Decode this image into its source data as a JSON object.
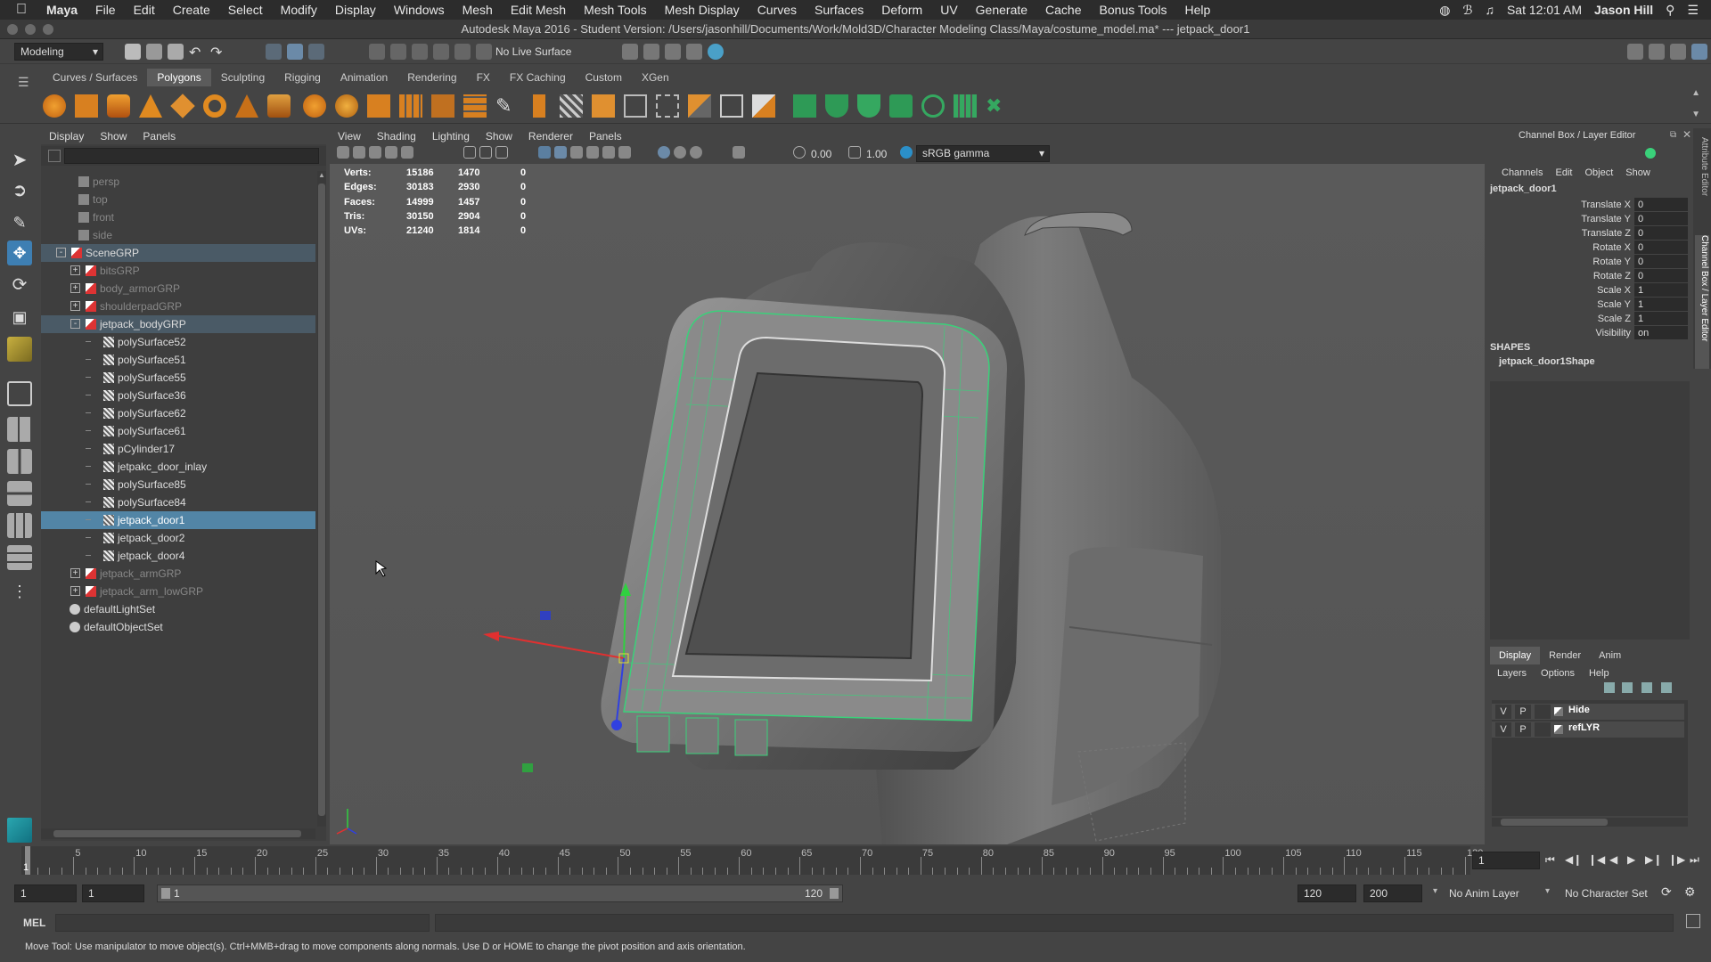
{
  "menubar": {
    "app": "Maya",
    "items": [
      "File",
      "Edit",
      "Create",
      "Select",
      "Modify",
      "Display",
      "Windows",
      "Mesh",
      "Edit Mesh",
      "Mesh Tools",
      "Mesh Display",
      "Curves",
      "Surfaces",
      "Deform",
      "UV",
      "Generate",
      "Cache",
      "Bonus Tools",
      "Help"
    ],
    "clock": "Sat 12:01 AM",
    "user": "Jason Hill"
  },
  "window_title": "Autodesk Maya 2016 - Student Version: /Users/jasonhill/Documents/Work/Mold3D/Character Modeling Class/Maya/costume_model.ma*  ---  jetpack_door1",
  "statusline": {
    "menuset": "Modeling",
    "live_surface": "No Live Surface"
  },
  "shelf": {
    "tabs": [
      "Curves / Surfaces",
      "Polygons",
      "Sculpting",
      "Rigging",
      "Animation",
      "Rendering",
      "FX",
      "FX Caching",
      "Custom",
      "XGen"
    ],
    "active": "Polygons"
  },
  "outliner": {
    "menu": [
      "Display",
      "Show",
      "Panels"
    ],
    "rows": [
      {
        "label": "persp",
        "depth": 2,
        "style": "grey",
        "kind": "camera"
      },
      {
        "label": "top",
        "depth": 2,
        "style": "grey",
        "kind": "camera"
      },
      {
        "label": "front",
        "depth": 2,
        "style": "grey",
        "kind": "camera"
      },
      {
        "label": "side",
        "depth": 2,
        "style": "grey",
        "kind": "camera"
      },
      {
        "label": "SceneGRP",
        "depth": 1,
        "style": "hl",
        "kind": "group",
        "exp": "-"
      },
      {
        "label": "bitsGRP",
        "depth": 2,
        "style": "grey",
        "kind": "group",
        "exp": "+"
      },
      {
        "label": "body_armorGRP",
        "depth": 2,
        "style": "grey",
        "kind": "group",
        "exp": "+"
      },
      {
        "label": "shoulderpadGRP",
        "depth": 2,
        "style": "grey",
        "kind": "group",
        "exp": "+"
      },
      {
        "label": "jetpack_bodyGRP",
        "depth": 2,
        "style": "hl",
        "kind": "group",
        "exp": "-"
      },
      {
        "label": "polySurface52",
        "depth": 3,
        "style": "",
        "kind": "mesh"
      },
      {
        "label": "polySurface51",
        "depth": 3,
        "style": "",
        "kind": "mesh"
      },
      {
        "label": "polySurface55",
        "depth": 3,
        "style": "",
        "kind": "mesh"
      },
      {
        "label": "polySurface36",
        "depth": 3,
        "style": "",
        "kind": "mesh"
      },
      {
        "label": "polySurface62",
        "depth": 3,
        "style": "",
        "kind": "mesh"
      },
      {
        "label": "polySurface61",
        "depth": 3,
        "style": "",
        "kind": "mesh"
      },
      {
        "label": "pCylinder17",
        "depth": 3,
        "style": "",
        "kind": "mesh"
      },
      {
        "label": "jetpakc_door_inlay",
        "depth": 3,
        "style": "",
        "kind": "mesh"
      },
      {
        "label": "polySurface85",
        "depth": 3,
        "style": "",
        "kind": "mesh"
      },
      {
        "label": "polySurface84",
        "depth": 3,
        "style": "",
        "kind": "mesh"
      },
      {
        "label": "jetpack_door1",
        "depth": 3,
        "style": "sel",
        "kind": "mesh"
      },
      {
        "label": "jetpack_door2",
        "depth": 3,
        "style": "",
        "kind": "mesh"
      },
      {
        "label": "jetpack_door4",
        "depth": 3,
        "style": "",
        "kind": "mesh"
      },
      {
        "label": "jetpack_armGRP",
        "depth": 2,
        "style": "grey",
        "kind": "group",
        "exp": "+"
      },
      {
        "label": "jetpack_arm_lowGRP",
        "depth": 2,
        "style": "grey",
        "kind": "group",
        "exp": "+"
      },
      {
        "label": "defaultLightSet",
        "depth": 1,
        "style": "",
        "kind": "set"
      },
      {
        "label": "defaultObjectSet",
        "depth": 1,
        "style": "",
        "kind": "set"
      }
    ]
  },
  "viewport": {
    "menu": [
      "View",
      "Shading",
      "Lighting",
      "Show",
      "Renderer",
      "Panels"
    ],
    "exposure": "0.00",
    "gamma": "1.00",
    "colorspace": "sRGB gamma",
    "hud": [
      {
        "label": "Verts:",
        "a": "15186",
        "b": "1470",
        "c": "0"
      },
      {
        "label": "Edges:",
        "a": "30183",
        "b": "2930",
        "c": "0"
      },
      {
        "label": "Faces:",
        "a": "14999",
        "b": "1457",
        "c": "0"
      },
      {
        "label": "Tris:",
        "a": "30150",
        "b": "2904",
        "c": "0"
      },
      {
        "label": "UVs:",
        "a": "21240",
        "b": "1814",
        "c": "0"
      }
    ]
  },
  "channelbox": {
    "title": "Channel Box / Layer Editor",
    "menu": [
      "Channels",
      "Edit",
      "Object",
      "Show"
    ],
    "object": "jetpack_door1",
    "attrs": [
      {
        "name": "Translate X",
        "value": "0"
      },
      {
        "name": "Translate Y",
        "value": "0"
      },
      {
        "name": "Translate Z",
        "value": "0"
      },
      {
        "name": "Rotate X",
        "value": "0"
      },
      {
        "name": "Rotate Y",
        "value": "0"
      },
      {
        "name": "Rotate Z",
        "value": "0"
      },
      {
        "name": "Scale X",
        "value": "1"
      },
      {
        "name": "Scale Y",
        "value": "1"
      },
      {
        "name": "Scale Z",
        "value": "1"
      },
      {
        "name": "Visibility",
        "value": "on"
      }
    ],
    "shapes_label": "SHAPES",
    "shape": "jetpack_door1Shape",
    "side_tabs": [
      "Attribute Editor",
      "Channel Box / Layer Editor"
    ]
  },
  "layers": {
    "tabs": [
      "Display",
      "Render",
      "Anim"
    ],
    "active": "Display",
    "menu": [
      "Layers",
      "Options",
      "Help"
    ],
    "rows": [
      {
        "v": "V",
        "p": "P",
        "name": "Hide"
      },
      {
        "v": "V",
        "p": "P",
        "name": "refLYR"
      }
    ]
  },
  "timeline": {
    "ticks": [
      "5",
      "10",
      "15",
      "20",
      "25",
      "30",
      "35",
      "40",
      "45",
      "50",
      "55",
      "60",
      "65",
      "70",
      "75",
      "80",
      "85",
      "90",
      "95",
      "100",
      "105",
      "110",
      "115",
      "120"
    ],
    "start_label": "1",
    "current": "1"
  },
  "range": {
    "start": "1",
    "min": "1",
    "slider_start": "1",
    "slider_end": "120",
    "end": "120",
    "max": "200",
    "anim_layer": "No Anim Layer",
    "char_set": "No Character Set"
  },
  "mel": {
    "label": "MEL"
  },
  "help_line": "Move Tool: Use manipulator to move object(s). Ctrl+MMB+drag to move components along normals. Use D or HOME to change the pivot position and axis orientation."
}
